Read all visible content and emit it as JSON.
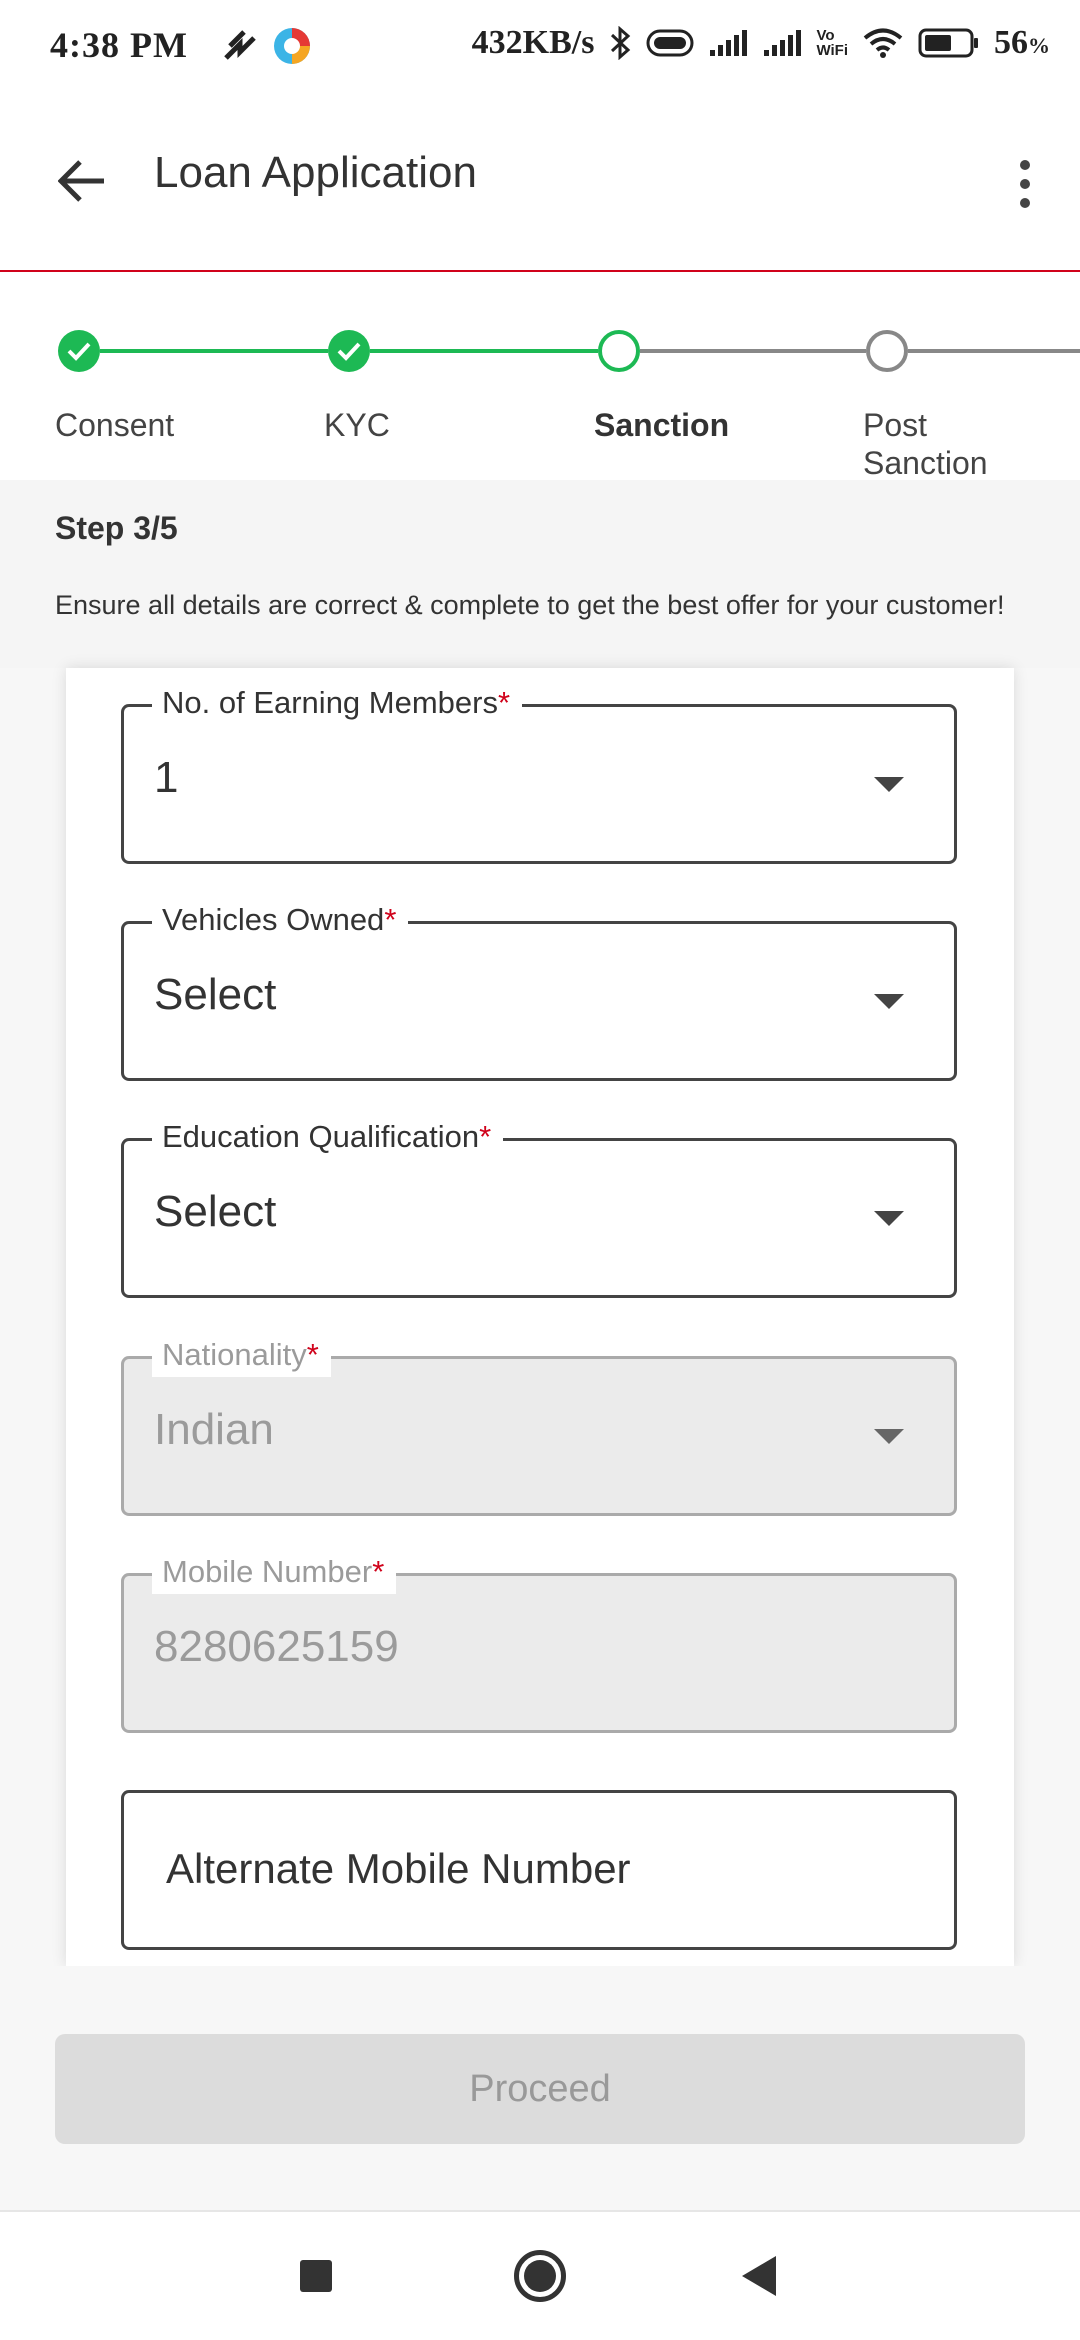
{
  "status_bar": {
    "time": "4:38 PM",
    "speed": "432KB/s",
    "vowifi_top": "Vo",
    "vowifi_bottom": "WiFi",
    "battery_percent": "56",
    "battery_unit": "%"
  },
  "app_bar": {
    "title": "Loan Application"
  },
  "stepper": {
    "steps": [
      {
        "label": "Consent",
        "state": "done"
      },
      {
        "label": "KYC",
        "state": "done"
      },
      {
        "label": "Sanction",
        "state": "current"
      },
      {
        "label": "Post Sanction",
        "label_line1": "Post",
        "label_line2": "Sanction",
        "state": "pending"
      }
    ],
    "colors": {
      "done": "#1db954",
      "pending": "#888888"
    }
  },
  "step_info": {
    "step_count": "Step 3/5",
    "hint": "Ensure all details are correct & complete to get the best offer for your customer!"
  },
  "form": {
    "fields": [
      {
        "label": "No. of Earning Members",
        "required_mark": "*",
        "value": "1",
        "type": "dropdown",
        "disabled": false
      },
      {
        "label": "Vehicles Owned",
        "required_mark": "*",
        "value": "Select",
        "type": "dropdown",
        "disabled": false
      },
      {
        "label": "Education Qualification",
        "required_mark": "*",
        "value": "Select",
        "type": "dropdown",
        "disabled": false
      },
      {
        "label": "Nationality",
        "required_mark": "*",
        "value": "Indian",
        "type": "dropdown",
        "disabled": true
      },
      {
        "label": "Mobile Number",
        "required_mark": "*",
        "value": "8280625159",
        "type": "text",
        "disabled": true
      },
      {
        "label": "",
        "placeholder": "Alternate Mobile Number",
        "type": "text",
        "disabled": false
      }
    ]
  },
  "actions": {
    "proceed_label": "Proceed"
  },
  "colors": {
    "accent_red": "#d0021b",
    "success_green": "#1db954",
    "disabled_button": "#dcdcdc"
  }
}
